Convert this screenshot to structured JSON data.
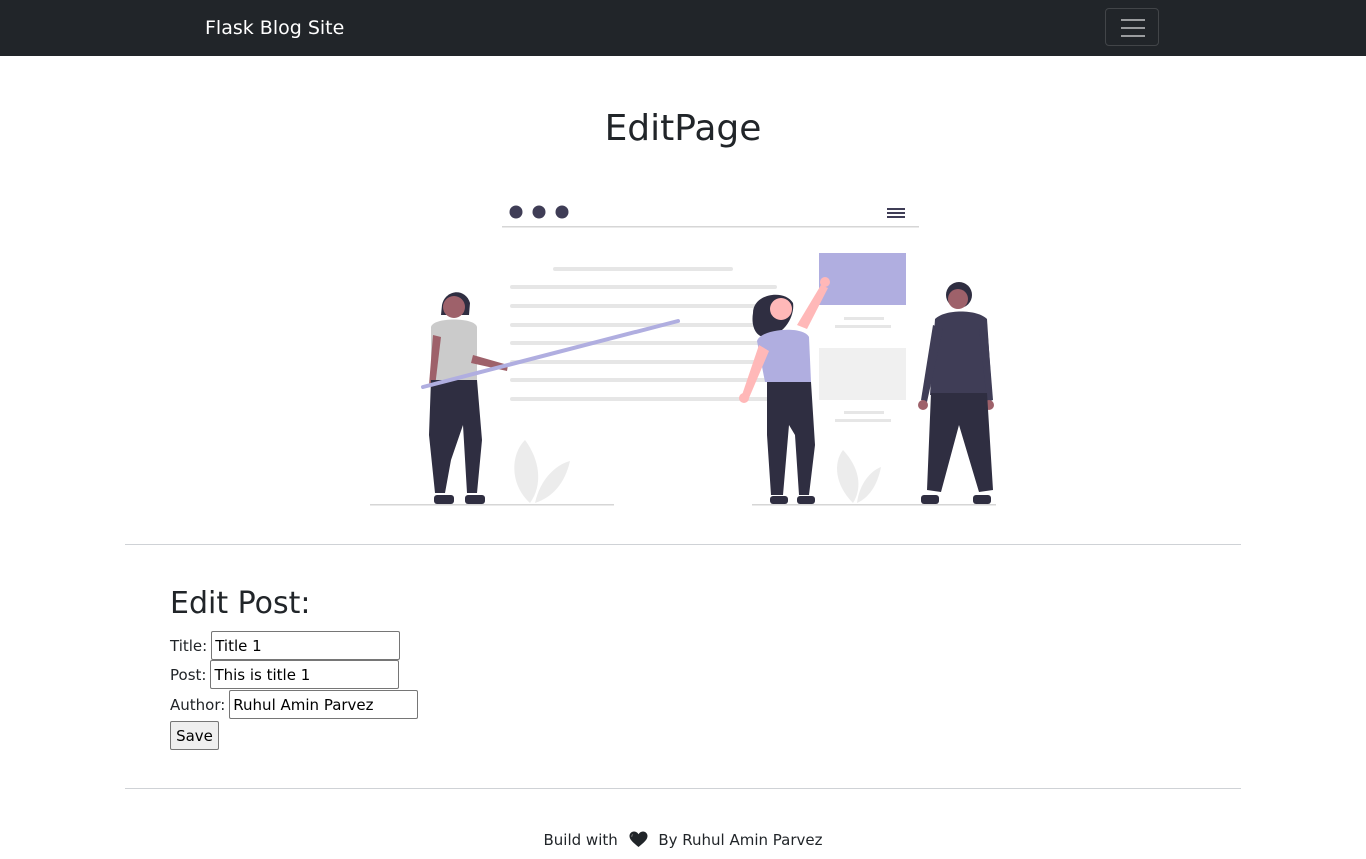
{
  "navbar": {
    "brand": "Flask Blog Site",
    "toggler_icon": "hamburger-menu-icon"
  },
  "page": {
    "title": "EditPage",
    "hero_image": "team-collaboration-illustration"
  },
  "form": {
    "heading": "Edit Post:",
    "title_label": "Title:",
    "title_value": "Title 1",
    "post_label": "Post:",
    "post_value": "This is title 1",
    "author_label": "Author:",
    "author_value": "Ruhul Amin Parvez",
    "save_label": "Save"
  },
  "footer": {
    "prefix": "Build with",
    "heart_icon": "heart-icon",
    "suffix": "By Ruhul Amin Parvez"
  },
  "colors": {
    "navbar_bg": "#212529",
    "accent_purple": "#b0aee0",
    "dark_figure": "#2f2e41"
  }
}
